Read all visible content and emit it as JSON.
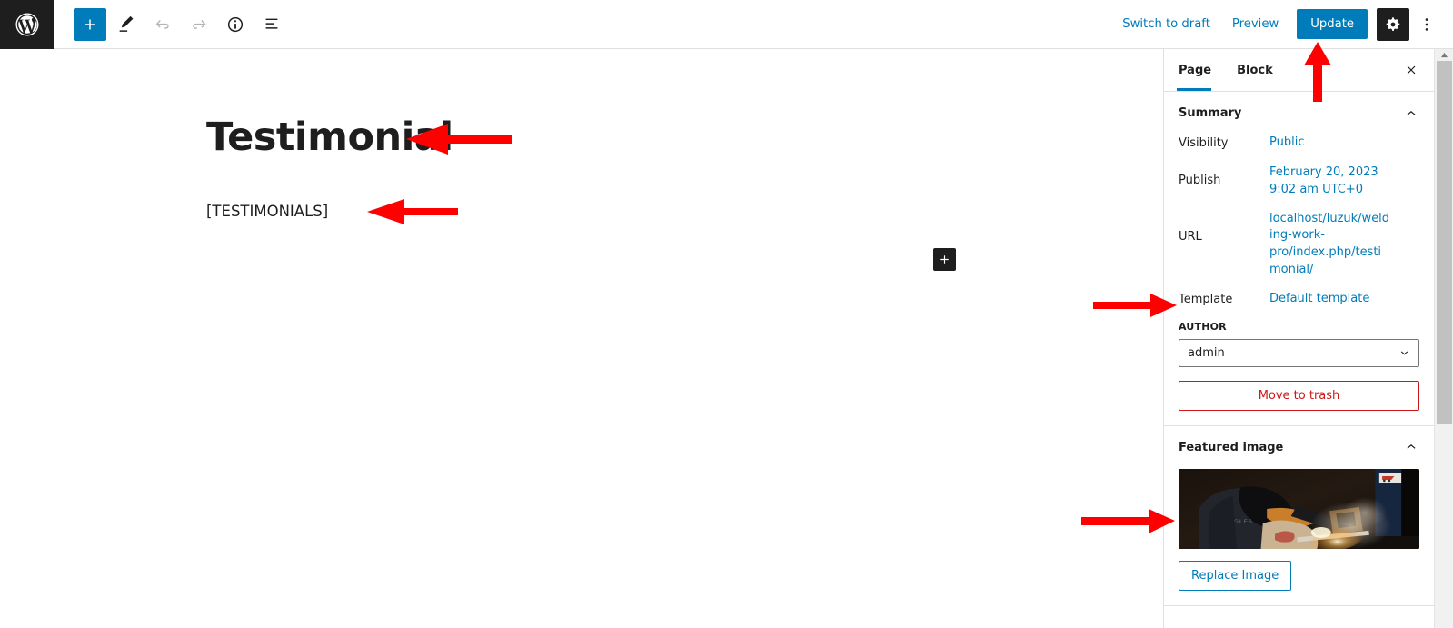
{
  "app": {
    "name": "WordPress Block Editor",
    "accent_color": "#007cba",
    "dark_color": "#1e1e1e",
    "danger_color": "#cc1818",
    "annotation_color": "#ff0000"
  },
  "toolbar": {
    "logo_icon": "wordpress-logo-icon",
    "left_buttons": [
      {
        "name": "add-block-button",
        "icon": "plus-icon",
        "label": "Toggle block inserter",
        "state": "primary"
      },
      {
        "name": "tools-button",
        "icon": "pencil-icon",
        "label": "Tools",
        "state": "normal"
      },
      {
        "name": "undo-button",
        "icon": "undo-icon",
        "label": "Undo",
        "state": "disabled"
      },
      {
        "name": "redo-button",
        "icon": "redo-icon",
        "label": "Redo",
        "state": "disabled"
      },
      {
        "name": "details-button",
        "icon": "info-icon",
        "label": "Details",
        "state": "normal"
      },
      {
        "name": "list-view-button",
        "icon": "list-view-icon",
        "label": "List View",
        "state": "normal"
      }
    ],
    "switch_to_draft": "Switch to draft",
    "preview": "Preview",
    "update": "Update",
    "settings_icon": "gear-icon",
    "settings_label": "Settings",
    "more_icon": "ellipsis-vertical-icon",
    "more_label": "Options"
  },
  "canvas": {
    "post_title": "Testimonial",
    "post_body": "[TESTIMONIALS]",
    "inserter_icon": "plus-icon",
    "inserter_label": "Add block"
  },
  "sidebar": {
    "tabs": [
      {
        "name": "tab-page",
        "label": "Page",
        "active": true
      },
      {
        "name": "tab-block",
        "label": "Block",
        "active": false
      }
    ],
    "close_icon": "close-icon",
    "summary": {
      "title": "Summary",
      "chevron_icon": "chevron-up-icon",
      "rows": [
        {
          "label": "Visibility",
          "value": "Public"
        },
        {
          "label": "Publish",
          "value": "February 20, 2023 9:02 am UTC+0"
        },
        {
          "label": "URL",
          "value": "localhost/luzuk/welding-work-pro/index.php/testimonial/"
        },
        {
          "label": "Template",
          "value": "Default template"
        }
      ],
      "author_label": "AUTHOR",
      "author_value": "admin",
      "author_chevron_icon": "chevron-down-icon",
      "trash_label": "Move to trash"
    },
    "featured_image": {
      "title": "Featured image",
      "chevron_icon": "chevron-up-icon",
      "thumbnail_alt": "welder-at-work-photo",
      "replace_label": "Replace Image"
    }
  },
  "scrollbar": {
    "name": "sidebar-scrollbar",
    "arrow_icon": "triangle-up-icon"
  },
  "annotations": [
    {
      "name": "annotation-arrow-title",
      "direction": "left",
      "target": "post-title"
    },
    {
      "name": "annotation-arrow-body",
      "direction": "left",
      "target": "post-body"
    },
    {
      "name": "annotation-arrow-update",
      "direction": "up",
      "target": "update-button"
    },
    {
      "name": "annotation-arrow-template",
      "direction": "right",
      "target": "template-row"
    },
    {
      "name": "annotation-arrow-featured-image",
      "direction": "right",
      "target": "featured-image"
    }
  ]
}
